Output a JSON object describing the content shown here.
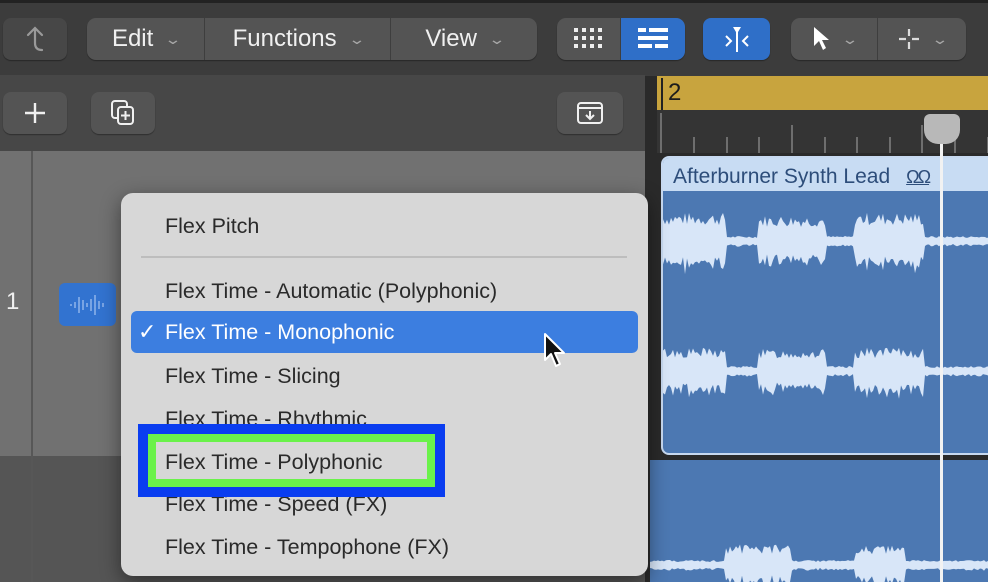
{
  "toolbar": {
    "back_icon": "back-arrow-icon",
    "menus": [
      {
        "label": "Edit",
        "chevron": "⌄"
      },
      {
        "label": "Functions",
        "chevron": "⌄"
      },
      {
        "label": "View",
        "chevron": "⌄"
      }
    ],
    "view_toggle": {
      "grid_icon": "grid-view-icon",
      "list_icon": "list-view-icon",
      "active": "list"
    },
    "flex_button": {
      "icon": "flex-icon",
      "active": true
    },
    "tools": [
      {
        "icon": "pointer-tool-icon",
        "chevron": "⌄"
      },
      {
        "icon": "crosshair-tool-icon",
        "chevron": "⌄"
      }
    ]
  },
  "track_toolbar": {
    "add_track_icon": "plus-icon",
    "duplicate_track_icon": "duplicate-icon",
    "catch_icon": "download-tray-icon"
  },
  "ruler": {
    "bar_number": "2"
  },
  "tracks": [
    {
      "number": "1",
      "icon": "audio-waveform-icon"
    }
  ],
  "region": {
    "name": "Afterburner Synth Lead",
    "loop_indicator": "ΩΩ"
  },
  "flex_menu": {
    "items": [
      {
        "label": "Flex Pitch",
        "checked": false
      },
      {
        "label": "Flex Time - Automatic (Polyphonic)",
        "checked": false
      },
      {
        "label": "Flex Time - Monophonic",
        "checked": true
      },
      {
        "label": "Flex Time - Slicing",
        "checked": false
      },
      {
        "label": "Flex Time - Rhythmic",
        "checked": false
      },
      {
        "label": "Flex Time - Polyphonic",
        "checked": false,
        "highlighted_annotation": true
      },
      {
        "label": "Flex Time - Speed (FX)",
        "checked": false
      },
      {
        "label": "Flex Time - Tempophone (FX)",
        "checked": false
      }
    ],
    "check_glyph": "✓"
  },
  "colors": {
    "accent": "#3c7ee0",
    "ruler": "#c8a43e",
    "region": "#4c78b2",
    "annotation_outer": "#0a3df0",
    "annotation_inner": "#6af24a"
  }
}
